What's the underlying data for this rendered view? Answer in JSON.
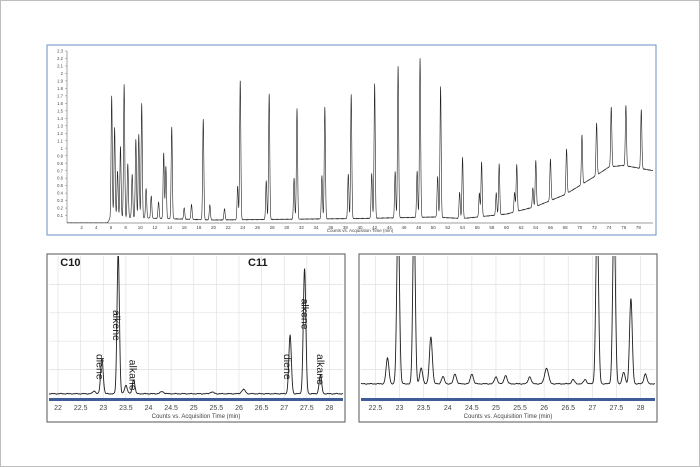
{
  "colors": {
    "trace": "#1f1f1f",
    "grid": "#dfe1e6",
    "axis_bar": "#3e5c95",
    "frame_blue": "#6e8cc4",
    "frame_dark": "#555555",
    "tick_text": "#555555"
  },
  "chart_data": [
    {
      "type": "line",
      "xlabel": "Counts vs. Acquisition Time (min)",
      "ylabel": "",
      "xlim": [
        0,
        80
      ],
      "ylim": [
        0,
        2.3
      ],
      "x_ticks": [
        2,
        4,
        6,
        8,
        10,
        12,
        14,
        16,
        18,
        20,
        22,
        24,
        26,
        28,
        30,
        32,
        34,
        36,
        38,
        40,
        42,
        44,
        46,
        48,
        50,
        52,
        54,
        56,
        58,
        60,
        62,
        64,
        66,
        68,
        70,
        72,
        74,
        76,
        78
      ],
      "y_ticks": [
        0.1,
        0.2,
        0.3,
        0.4,
        0.5,
        0.6,
        0.7,
        0.8,
        0.9,
        1,
        1.1,
        1.2,
        1.3,
        1.4,
        1.5,
        1.6,
        1.7,
        1.8,
        1.9,
        2,
        2.1,
        2.2,
        2.3
      ],
      "grid": false,
      "series": [
        {
          "baseline": [
            [
              0,
              0
            ],
            [
              5.5,
              0
            ],
            [
              6,
              0.08
            ],
            [
              20,
              0.04
            ],
            [
              40,
              0.06
            ],
            [
              50,
              0.08
            ],
            [
              54,
              0.06
            ],
            [
              60,
              0.12
            ],
            [
              64,
              0.22
            ],
            [
              68,
              0.38
            ],
            [
              72,
              0.62
            ],
            [
              74,
              0.75
            ],
            [
              76,
              0.77
            ],
            [
              80,
              0.7
            ]
          ],
          "peaks": [
            {
              "x": 6.1,
              "y": 1.62,
              "w": 0.08
            },
            {
              "x": 6.5,
              "y": 1.2,
              "w": 0.08
            },
            {
              "x": 6.9,
              "y": 0.62,
              "w": 0.08
            },
            {
              "x": 7.3,
              "y": 0.95,
              "w": 0.08
            },
            {
              "x": 7.8,
              "y": 1.78,
              "w": 0.08
            },
            {
              "x": 8.3,
              "y": 0.72,
              "w": 0.08
            },
            {
              "x": 8.9,
              "y": 0.58,
              "w": 0.08
            },
            {
              "x": 9.4,
              "y": 1.05,
              "w": 0.08
            },
            {
              "x": 9.8,
              "y": 1.12,
              "w": 0.08
            },
            {
              "x": 10.2,
              "y": 1.53,
              "w": 0.08
            },
            {
              "x": 10.8,
              "y": 0.4,
              "w": 0.08
            },
            {
              "x": 11.5,
              "y": 0.3,
              "w": 0.08
            },
            {
              "x": 12.5,
              "y": 0.22,
              "w": 0.08
            },
            {
              "x": 13.2,
              "y": 0.88,
              "w": 0.08
            },
            {
              "x": 13.5,
              "y": 0.7,
              "w": 0.08
            },
            {
              "x": 14.3,
              "y": 1.23,
              "w": 0.08
            },
            {
              "x": 16.0,
              "y": 0.15,
              "w": 0.08
            },
            {
              "x": 17.0,
              "y": 0.2,
              "w": 0.08
            },
            {
              "x": 18.6,
              "y": 1.35,
              "w": 0.08
            },
            {
              "x": 19.5,
              "y": 0.2,
              "w": 0.08
            },
            {
              "x": 21.5,
              "y": 0.15,
              "w": 0.08
            },
            {
              "x": 23.3,
              "y": 0.45,
              "w": 0.08
            },
            {
              "x": 23.65,
              "y": 1.87,
              "w": 0.08
            },
            {
              "x": 27.2,
              "y": 0.52,
              "w": 0.08
            },
            {
              "x": 27.6,
              "y": 1.68,
              "w": 0.08
            },
            {
              "x": 31.0,
              "y": 0.55,
              "w": 0.08
            },
            {
              "x": 31.4,
              "y": 1.48,
              "w": 0.08
            },
            {
              "x": 34.8,
              "y": 0.58,
              "w": 0.08
            },
            {
              "x": 35.2,
              "y": 1.5,
              "w": 0.08
            },
            {
              "x": 38.4,
              "y": 0.6,
              "w": 0.08
            },
            {
              "x": 38.8,
              "y": 1.66,
              "w": 0.08
            },
            {
              "x": 41.6,
              "y": 0.6,
              "w": 0.08
            },
            {
              "x": 42.0,
              "y": 1.8,
              "w": 0.08
            },
            {
              "x": 44.8,
              "y": 0.62,
              "w": 0.08
            },
            {
              "x": 45.2,
              "y": 2.03,
              "w": 0.08
            },
            {
              "x": 47.8,
              "y": 0.62,
              "w": 0.08
            },
            {
              "x": 48.2,
              "y": 2.13,
              "w": 0.08
            },
            {
              "x": 50.6,
              "y": 0.55,
              "w": 0.08
            },
            {
              "x": 51.0,
              "y": 1.75,
              "w": 0.08
            },
            {
              "x": 53.6,
              "y": 0.35,
              "w": 0.08
            },
            {
              "x": 54.0,
              "y": 0.82,
              "w": 0.08
            },
            {
              "x": 56.3,
              "y": 0.32,
              "w": 0.08
            },
            {
              "x": 56.6,
              "y": 0.73,
              "w": 0.08
            },
            {
              "x": 58.6,
              "y": 0.3,
              "w": 0.08
            },
            {
              "x": 59.0,
              "y": 0.68,
              "w": 0.08
            },
            {
              "x": 61.1,
              "y": 0.26,
              "w": 0.08
            },
            {
              "x": 61.4,
              "y": 0.63,
              "w": 0.08
            },
            {
              "x": 63.6,
              "y": 0.26,
              "w": 0.08
            },
            {
              "x": 64.0,
              "y": 0.62,
              "w": 0.08
            },
            {
              "x": 66.0,
              "y": 0.56,
              "w": 0.08
            },
            {
              "x": 68.2,
              "y": 0.6,
              "w": 0.08
            },
            {
              "x": 70.3,
              "y": 0.66,
              "w": 0.08
            },
            {
              "x": 72.3,
              "y": 0.7,
              "w": 0.08
            },
            {
              "x": 74.3,
              "y": 0.8,
              "w": 0.08
            },
            {
              "x": 76.3,
              "y": 0.81,
              "w": 0.08
            },
            {
              "x": 78.4,
              "y": 0.79,
              "w": 0.08
            }
          ]
        }
      ]
    },
    {
      "type": "line",
      "xlabel": "Counts vs. Acquisition Time (min)",
      "ylabel": "",
      "xlim": [
        21.8,
        28.3
      ],
      "ylim": [
        0,
        1
      ],
      "x_ticks": [
        22,
        22.5,
        23,
        23.5,
        24,
        24.5,
        25,
        25.5,
        26,
        26.5,
        27,
        27.5,
        28
      ],
      "grid": true,
      "annotations": [
        {
          "text": "C10",
          "x": 22.05,
          "y": 0.93,
          "bold": true,
          "rotate": false
        },
        {
          "text": "C11",
          "x": 26.2,
          "y": 0.93,
          "bold": true,
          "rotate": false
        },
        {
          "text": "diene",
          "x": 22.85,
          "y": 0.31,
          "bold": false,
          "rotate": true
        },
        {
          "text": "alkene",
          "x": 23.22,
          "y": 0.62,
          "bold": false,
          "rotate": true
        },
        {
          "text": "alkane",
          "x": 23.58,
          "y": 0.27,
          "bold": false,
          "rotate": true
        },
        {
          "text": "diene",
          "x": 27.0,
          "y": 0.31,
          "bold": false,
          "rotate": true
        },
        {
          "text": "alkene",
          "x": 27.38,
          "y": 0.7,
          "bold": false,
          "rotate": true
        },
        {
          "text": "alkane",
          "x": 27.72,
          "y": 0.31,
          "bold": false,
          "rotate": true
        }
      ],
      "series": [
        {
          "baseline": [
            [
              21.8,
              0.03
            ],
            [
              28.3,
              0.03
            ]
          ],
          "peaks": [
            {
              "x": 22.8,
              "y": 0.02,
              "w": 0.03
            },
            {
              "x": 22.97,
              "y": 0.25,
              "w": 0.028
            },
            {
              "x": 23.33,
              "y": 1.0,
              "w": 0.026
            },
            {
              "x": 23.5,
              "y": 0.06,
              "w": 0.03
            },
            {
              "x": 23.67,
              "y": 0.1,
              "w": 0.028
            },
            {
              "x": 24.3,
              "y": 0.015,
              "w": 0.04
            },
            {
              "x": 25.4,
              "y": 0.012,
              "w": 0.04
            },
            {
              "x": 26.1,
              "y": 0.03,
              "w": 0.04
            },
            {
              "x": 27.13,
              "y": 0.41,
              "w": 0.028
            },
            {
              "x": 27.45,
              "y": 0.88,
              "w": 0.028
            },
            {
              "x": 27.8,
              "y": 0.13,
              "w": 0.028
            }
          ]
        }
      ]
    },
    {
      "type": "line",
      "xlabel": "Counts vs. Acquisition Time (min)",
      "ylabel": "",
      "xlim": [
        22.2,
        28.3
      ],
      "ylim": [
        0,
        1
      ],
      "x_ticks": [
        22.5,
        23,
        23.5,
        24,
        24.5,
        25,
        25.5,
        26,
        26.5,
        27,
        27.5,
        28
      ],
      "grid": true,
      "series": [
        {
          "baseline": [
            [
              22.2,
              0.1
            ],
            [
              28.3,
              0.1
            ]
          ],
          "peaks": [
            {
              "x": 22.75,
              "y": 0.18,
              "w": 0.03
            },
            {
              "x": 22.97,
              "y": 1.2,
              "w": 0.028
            },
            {
              "x": 23.3,
              "y": 1.2,
              "w": 0.026
            },
            {
              "x": 23.45,
              "y": 0.11,
              "w": 0.03
            },
            {
              "x": 23.65,
              "y": 0.33,
              "w": 0.03
            },
            {
              "x": 23.9,
              "y": 0.05,
              "w": 0.03
            },
            {
              "x": 24.15,
              "y": 0.07,
              "w": 0.03
            },
            {
              "x": 24.5,
              "y": 0.07,
              "w": 0.03
            },
            {
              "x": 25.0,
              "y": 0.05,
              "w": 0.03
            },
            {
              "x": 25.2,
              "y": 0.06,
              "w": 0.03
            },
            {
              "x": 25.7,
              "y": 0.05,
              "w": 0.03
            },
            {
              "x": 26.05,
              "y": 0.11,
              "w": 0.04
            },
            {
              "x": 26.6,
              "y": 0.03,
              "w": 0.03
            },
            {
              "x": 26.85,
              "y": 0.03,
              "w": 0.03
            },
            {
              "x": 27.1,
              "y": 1.2,
              "w": 0.028
            },
            {
              "x": 27.45,
              "y": 1.2,
              "w": 0.028
            },
            {
              "x": 27.65,
              "y": 0.08,
              "w": 0.03
            },
            {
              "x": 27.8,
              "y": 0.6,
              "w": 0.028
            },
            {
              "x": 28.1,
              "y": 0.07,
              "w": 0.03
            }
          ]
        }
      ]
    }
  ]
}
